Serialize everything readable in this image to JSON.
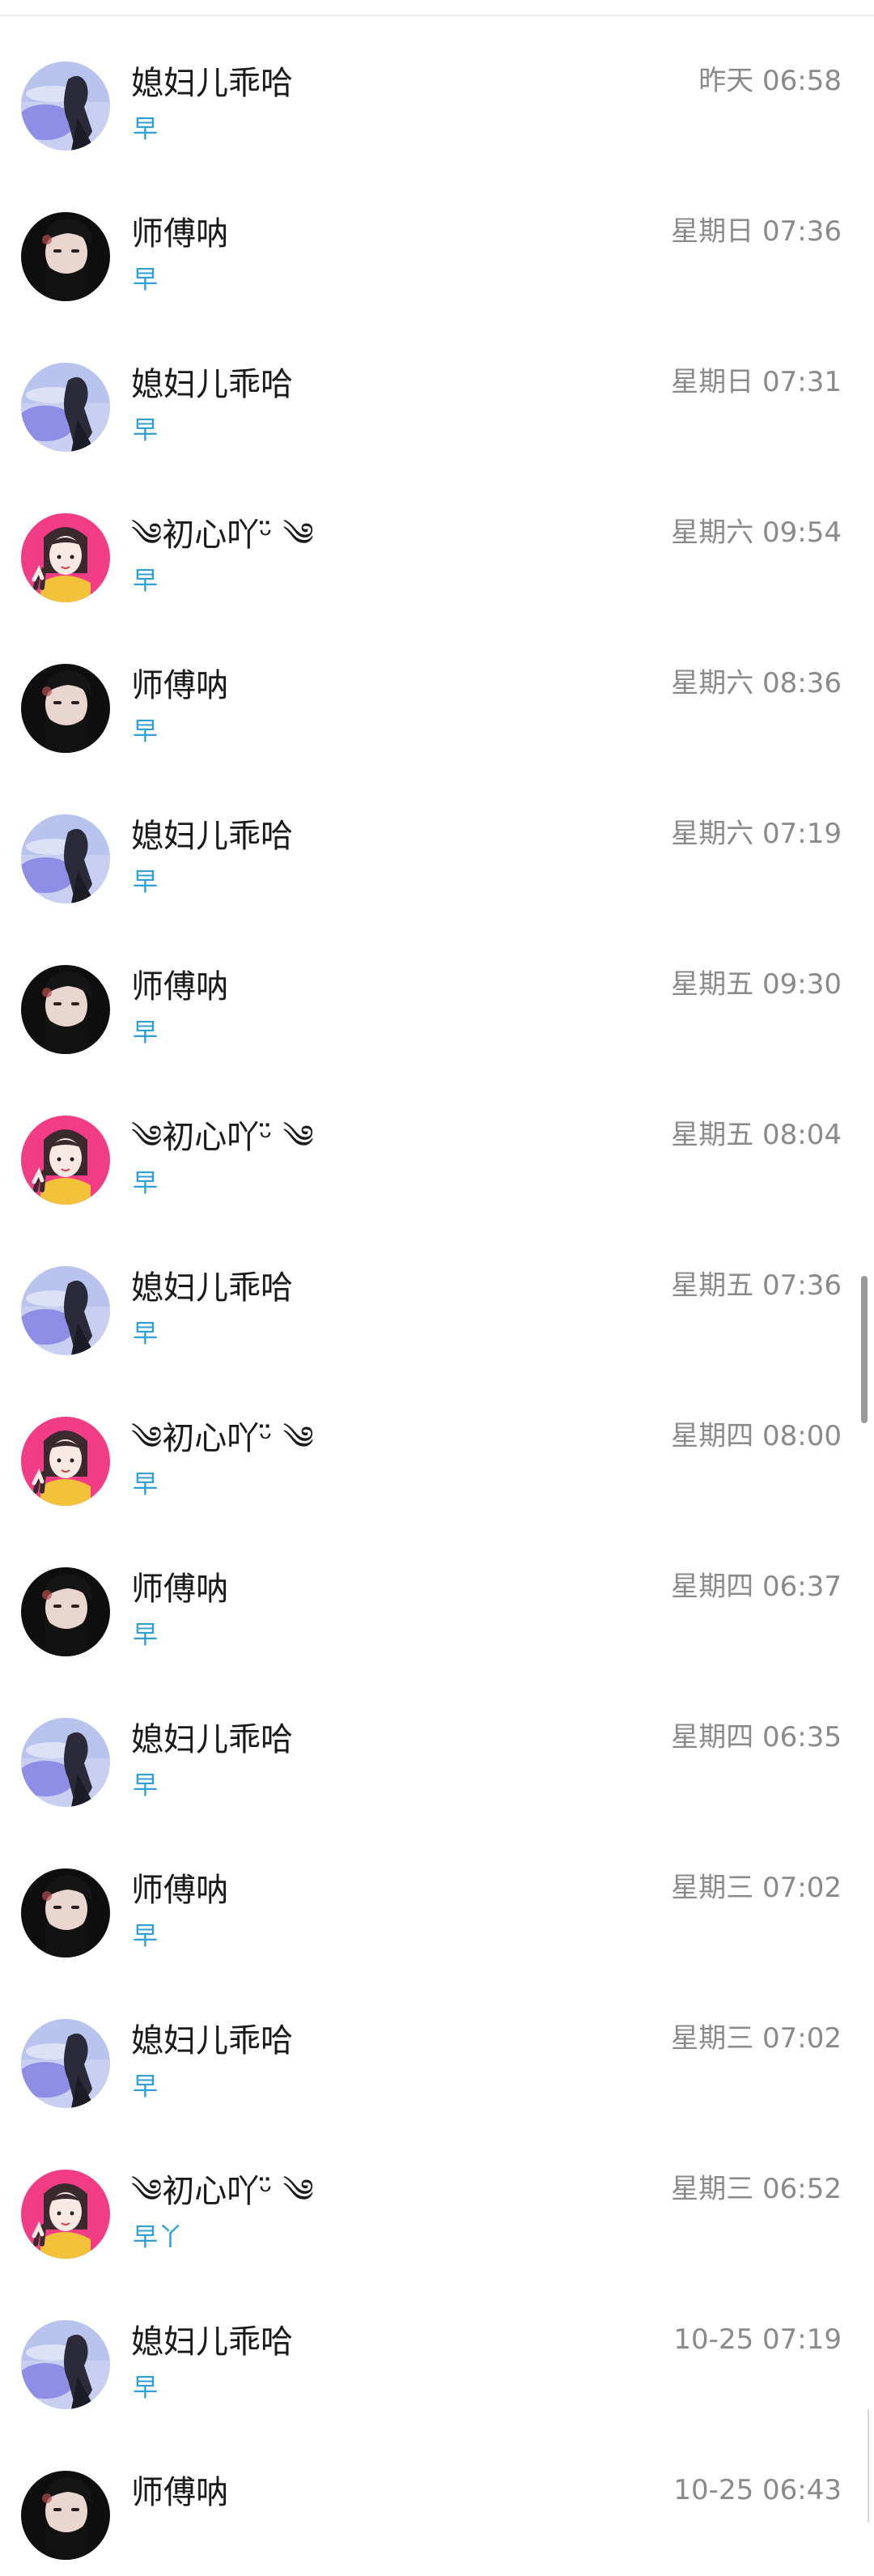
{
  "conversations": [
    {
      "name": "",
      "preview": "早",
      "time": "",
      "avatar": "cartoon-girl-pink-avatar"
    },
    {
      "name": "媳妇儿乖哈",
      "preview": "早",
      "time": "昨天 06:58",
      "avatar": "blue-sky-girl-avatar"
    },
    {
      "name": "师傅呐",
      "preview": "早",
      "time": "星期日 07:36",
      "avatar": "dark-portrait-avatar"
    },
    {
      "name": "媳妇儿乖哈",
      "preview": "早",
      "time": "星期日 07:31",
      "avatar": "blue-sky-girl-avatar"
    },
    {
      "name": "༄初心吖ᵕ̈ ༄",
      "preview": "早",
      "time": "星期六 09:54",
      "avatar": "cartoon-girl-pink-avatar"
    },
    {
      "name": "师傅呐",
      "preview": "早",
      "time": "星期六 08:36",
      "avatar": "dark-portrait-avatar"
    },
    {
      "name": "媳妇儿乖哈",
      "preview": "早",
      "time": "星期六 07:19",
      "avatar": "blue-sky-girl-avatar"
    },
    {
      "name": "师傅呐",
      "preview": "早",
      "time": "星期五 09:30",
      "avatar": "dark-portrait-avatar"
    },
    {
      "name": "༄初心吖ᵕ̈ ༄",
      "preview": "早",
      "time": "星期五 08:04",
      "avatar": "cartoon-girl-pink-avatar"
    },
    {
      "name": "媳妇儿乖哈",
      "preview": "早",
      "time": "星期五 07:36",
      "avatar": "blue-sky-girl-avatar"
    },
    {
      "name": "༄初心吖ᵕ̈ ༄",
      "preview": "早",
      "time": "星期四 08:00",
      "avatar": "cartoon-girl-pink-avatar"
    },
    {
      "name": "师傅呐",
      "preview": "早",
      "time": "星期四 06:37",
      "avatar": "dark-portrait-avatar"
    },
    {
      "name": "媳妇儿乖哈",
      "preview": "早",
      "time": "星期四 06:35",
      "avatar": "blue-sky-girl-avatar"
    },
    {
      "name": "师傅呐",
      "preview": "早",
      "time": "星期三 07:02",
      "avatar": "dark-portrait-avatar"
    },
    {
      "name": "媳妇儿乖哈",
      "preview": "早",
      "time": "星期三 07:02",
      "avatar": "blue-sky-girl-avatar"
    },
    {
      "name": "༄初心吖ᵕ̈ ༄",
      "preview": "早丫",
      "time": "星期三 06:52",
      "avatar": "cartoon-girl-pink-avatar"
    },
    {
      "name": "媳妇儿乖哈",
      "preview": "早",
      "time": "10-25 07:19",
      "avatar": "blue-sky-girl-avatar"
    },
    {
      "name": "师傅呐",
      "preview": "",
      "time": "10-25 06:43",
      "avatar": "dark-portrait-avatar"
    }
  ],
  "colors": {
    "name": "#1a1a1a",
    "preview": "#2e9fd8",
    "time": "#8a8a8a",
    "scrollbar": "#9a9a9a"
  }
}
